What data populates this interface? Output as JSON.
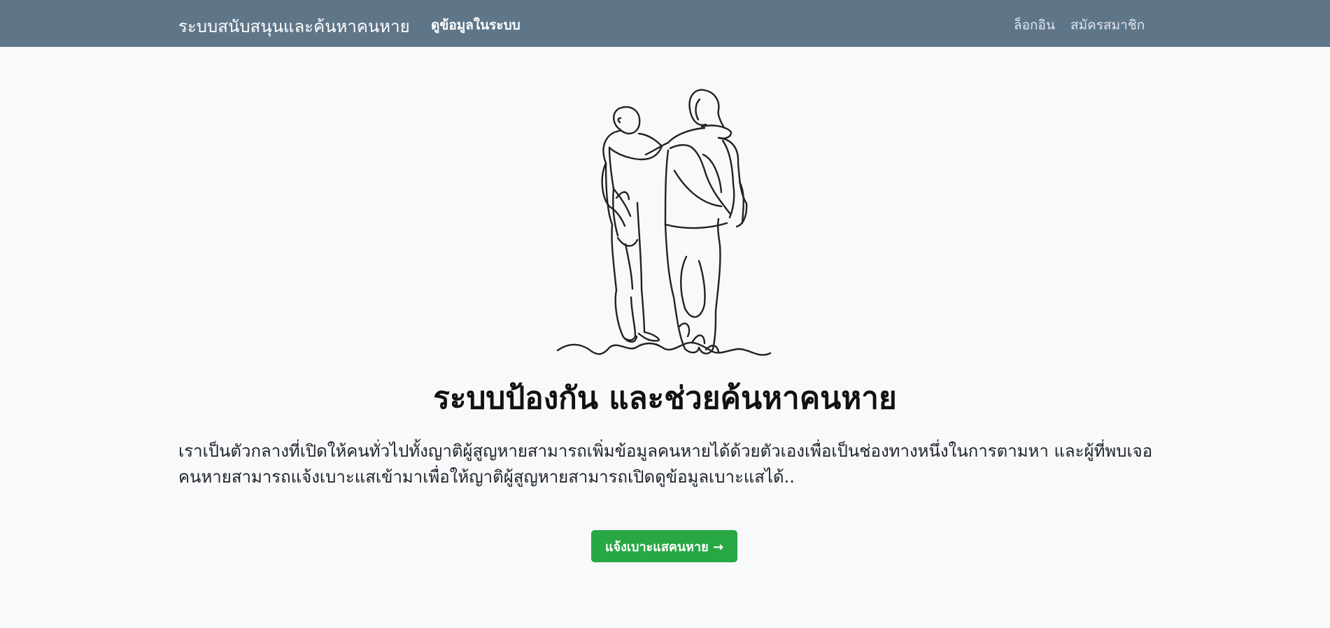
{
  "navbar": {
    "brand": "ระบบสนับสนุนและค้นหาคนหาย",
    "view_data": "ดูข้อมูลในระบบ",
    "login": "ล็อกอิน",
    "register": "สมัครสมาชิก"
  },
  "hero": {
    "title": "ระบบป้องกัน และช่วยค้นหาคนหาย",
    "description": "เราเป็นตัวกลางที่เปิดให้คนทั่วไปทั้งญาติผู้สูญหายสามารถเพิ่มข้อมูลคนหายได้ด้วยตัวเองเพื่อเป็นช่องทางหนึ่งในการตามหา และผู้ที่พบเจอคนหายสามารถแจ้งเบาะแสเข้ามาเพื่อให้ญาติผู้สูญหายสามารถเปิดดูข้อมูลเบาะแสได้..",
    "button_label": "แจ้งเบาะแสคนหาย →"
  },
  "illustration": {
    "icon": "two-people-line-art-icon"
  },
  "colors": {
    "navbar_bg": "#5f7689",
    "page_bg": "#f8f9fa",
    "button_bg": "#28a745",
    "line_art": "#222222"
  }
}
